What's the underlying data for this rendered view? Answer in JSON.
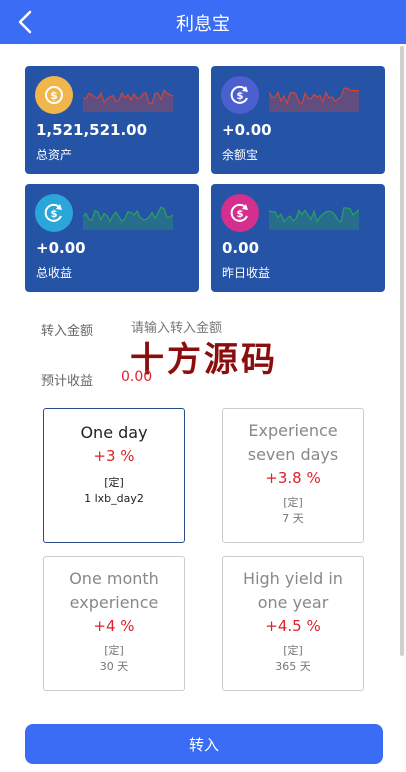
{
  "header": {
    "title": "利息宝"
  },
  "cards": [
    {
      "value": "1,521,521.00",
      "label": "总资产",
      "icon": "dollar-coin-icon",
      "icon_color": "#f1b64b",
      "spark_color": "#d0453a"
    },
    {
      "value": "+0.00",
      "label": "余额宝",
      "icon": "dollar-refresh-icon",
      "icon_color": "#4b5fce",
      "spark_color": "#d0453a"
    },
    {
      "value": "+0.00",
      "label": "总收益",
      "icon": "dollar-refresh-icon",
      "icon_color": "#2aa6d8",
      "spark_color": "#2aa05f"
    },
    {
      "value": "0.00",
      "label": "昨日收益",
      "icon": "dollar-refresh-icon",
      "icon_color": "#d42f8f",
      "spark_color": "#2aa05f"
    }
  ],
  "form": {
    "amount_label": "转入金额",
    "amount_placeholder": "请输入转入金额",
    "estimate_label": "预计收益",
    "estimate_value": "0.00"
  },
  "watermark": "十方源码",
  "plans": [
    {
      "name": "One day",
      "rate": "+3 %",
      "tag": "[定]",
      "days": "1 lxb_day2",
      "selected": true
    },
    {
      "name": "Experience seven days",
      "rate": "+3.8 %",
      "tag": "[定]",
      "days": "7 天",
      "selected": false
    },
    {
      "name": "One month experience",
      "rate": "+4 %",
      "tag": "[定]",
      "days": "30 天",
      "selected": false
    },
    {
      "name": "High yield in one year",
      "rate": "+4.5 %",
      "tag": "[定]",
      "days": "365 天",
      "selected": false
    }
  ],
  "submit_label": "转入"
}
